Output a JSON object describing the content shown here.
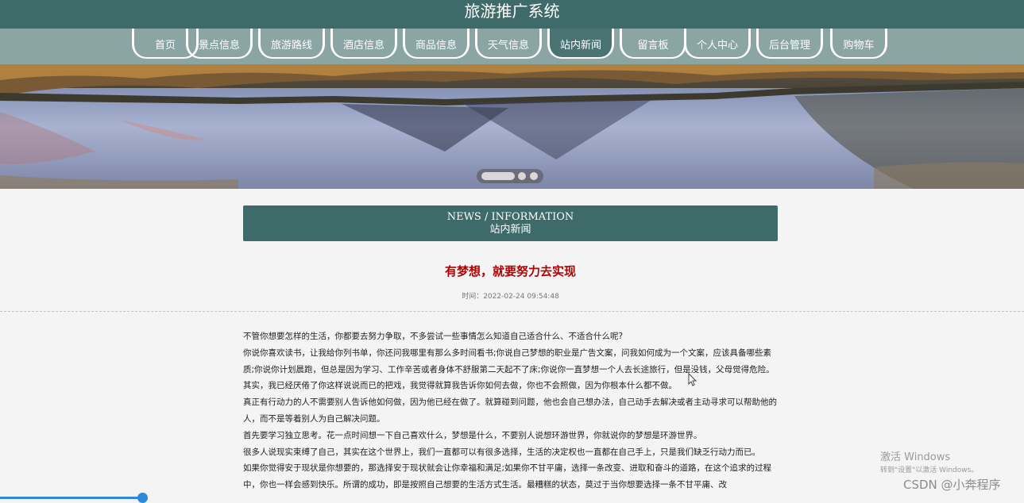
{
  "header": {
    "site_title": "旅游推广系统"
  },
  "nav": {
    "items": [
      {
        "label": "首页"
      },
      {
        "label": "景点信息"
      },
      {
        "label": "旅游路线"
      },
      {
        "label": "酒店信息"
      },
      {
        "label": "商品信息"
      },
      {
        "label": "天气信息"
      },
      {
        "label": "站内新闻"
      },
      {
        "label": "留言板"
      },
      {
        "label": "个人中心"
      },
      {
        "label": "后台管理"
      },
      {
        "label": "购物车"
      }
    ],
    "active": "站内新闻"
  },
  "section": {
    "en": "NEWS / INFORMATION",
    "cn": "站内新闻"
  },
  "article": {
    "title": "有梦想，就要努力去实现",
    "meta": "时间：2022-02-24 09:54:48",
    "paragraphs": [
      "不管你想要怎样的生活，你都要去努力争取，不多尝试一些事情怎么知道自己适合什么、不适合什么呢?",
      "你说你喜欢读书，让我给你列书单，你还问我哪里有那么多时间看书;你说自己梦想的职业是广告文案，问我如何成为一个文案，应该具备哪些素质;你说你计划晨跑，但总是因为学习、工作辛苦或者身体不舒服第二天起不了床;你说你一直梦想一个人去长途旅行，但是没钱，父母觉得危险。其实，我已经厌倦了你这样说说而已的把戏，我觉得就算我告诉你如何去做，你也不会照做，因为你根本什么都不做。",
      "真正有行动力的人不需要别人告诉他如何做，因为他已经在做了。就算碰到问题，他也会自己想办法，自己动手去解决或者主动寻求可以帮助他的人，而不是等着别人为自己解决问题。",
      "首先要学习独立思考。花一点时间想一下自己喜欢什么，梦想是什么，不要别人说想环游世界，你就说你的梦想是环游世界。",
      "很多人说现实束缚了自己，其实在这个世界上，我们一直都可以有很多选择，生活的决定权也一直都在自己手上，只是我们缺乏行动力而已。",
      "如果你觉得安于现状是你想要的，那选择安于现状就会让你幸福和满足;如果你不甘平庸，选择一条改变、进取和奋斗的道路，在这个追求的过程中，你也一样会感到快乐。所谓的成功，即是按照自己想要的生活方式生活。最糟糕的状态，莫过于当你想要选择一条不甘平庸、改"
    ]
  },
  "overlay": {
    "activate_title": "激活 Windows",
    "activate_sub": "转到\"设置\"以激活 Windows。",
    "watermark": "CSDN @小奔程序"
  },
  "colors": {
    "header_bg": "#3e6a6a",
    "nav_bg": "#8ba5a5",
    "title_red": "#b00000"
  }
}
